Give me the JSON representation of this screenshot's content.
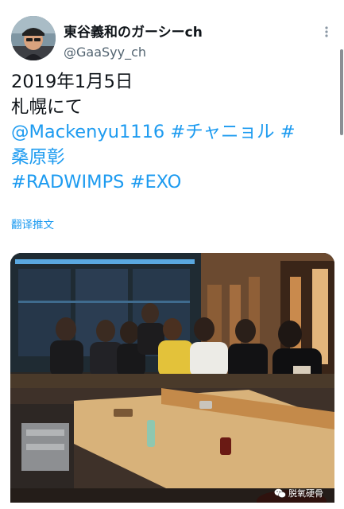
{
  "colors": {
    "link": "#1d9bf0",
    "text": "#0f1419",
    "secondary": "#536471",
    "background": "#ffffff"
  },
  "tweet": {
    "author": {
      "display_name": "東谷義和のガーシーch",
      "handle": "@GaaSyy_ch",
      "avatar_icon": "profile-photo"
    },
    "more_icon": "more-vertical-icon",
    "text": {
      "line1": "2019年1月5日",
      "line2": "札幌にて",
      "mention": "@Mackenyu1116",
      "hashtag_chanyeol": "#チャニョル",
      "hashtag_kuwabara_hash": "#",
      "hashtag_kuwabara_name": "桑原彰",
      "hashtag_radwimps": "#RADWIMPS",
      "hashtag_exo": "#EXO"
    },
    "translate_label": "翻译推文",
    "media": {
      "watermark_text": "脱氧硬骨",
      "watermark_icon": "wechat-icon"
    }
  }
}
